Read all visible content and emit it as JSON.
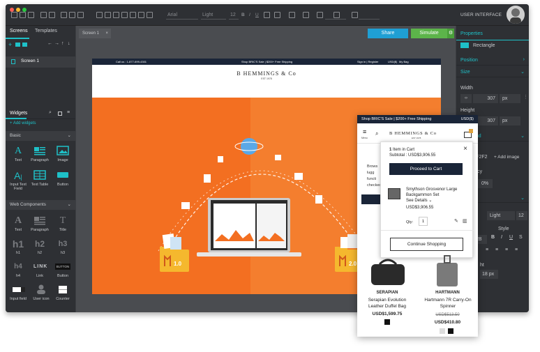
{
  "toolbar": {
    "font_name": "Arial",
    "font_weight": "Light",
    "font_size": "12",
    "view_label": "USER INTERFACE"
  },
  "left_panel": {
    "tabs": [
      "Screens",
      "Templates"
    ],
    "screens": [
      "Screen 1"
    ],
    "widgets_tab": "Widgets",
    "add_widgets": "+ Add widgets",
    "basic_label": "Basic",
    "basic_items": [
      "Text",
      "Paragraph",
      "Image",
      "Input Text Field",
      "Text Table",
      "Button"
    ],
    "web_components_label": "Web Components",
    "web_items": [
      "Text",
      "Paragraph",
      "Title",
      "h1",
      "h2",
      "h3",
      "h4",
      "Link",
      "Button",
      "Input field",
      "User icon",
      "Counter"
    ],
    "glyphs": {
      "h1": "h1",
      "h2": "h2",
      "h3": "h3",
      "h4": "h4",
      "link": "LINK",
      "button": "BUTTON"
    }
  },
  "center": {
    "tab_label": "Screen 1",
    "share_label": "Share",
    "simulate_label": "Simulate"
  },
  "site": {
    "top_left": "Call us : 1-877-699-4301",
    "top_center": "Shop BRIC'S Sale | $200+ Free Shipping",
    "top_right": "Sign in | Register",
    "top_currency": "USD($)",
    "top_bag": "My Bag",
    "logo": "B HEMMINGS & Co",
    "est": "EST 1978",
    "version_old": "1.0",
    "version_new": "2.0"
  },
  "right_panel": {
    "properties": "Properties",
    "shape": "Rectangle",
    "position": "Position",
    "size": "Size",
    "width_label": "Width",
    "width_value": "307",
    "width_unit": "px",
    "height_label": "Height",
    "height_value": "307",
    "height_unit": "px",
    "fill_fragment": "und",
    "hex_fragment": "F2F2F2",
    "add_image": "+ Add image",
    "opacity_fragment": "rency",
    "opacity_value": "0%",
    "font_weight": "Light",
    "font_size": "12",
    "style_label": "Style",
    "color_fragment": "2B",
    "line_fragment": "ht",
    "line_value": "18 px"
  },
  "mobile": {
    "top_banner": "Shop BRIC'S Sale | $200+ Free Shipping",
    "currency": "USD($)",
    "menu_label": "Menu",
    "logo": "B HEMMINGS & Co",
    "est": "EST 1978",
    "bg_text": [
      "Brows",
      "lugg",
      "functi",
      "checked"
    ],
    "cart": {
      "items_count": "1",
      "items_label": "Item in Cart",
      "subtotal": "Subtotal : USD$3,906.55",
      "proceed": "Proceed to Cart",
      "product_name": "Smythson Grosvenor Large Backgammon Set",
      "see_details": "See Details",
      "price": "USD$3,906.55",
      "qty_label": "Qty:",
      "qty_value": "1",
      "continue": "Continue Shopping"
    },
    "products": [
      {
        "brand": "SERAPIAN",
        "name": "Serapian Evolution Leather Duffel Bag",
        "price": "USD$1,599.75",
        "old_price": ""
      },
      {
        "brand": "HARTMANN",
        "name": "Hartmann 7R Carry-On Spinner",
        "price": "USD$410.80",
        "old_price": "USD$513.50"
      }
    ]
  },
  "colors": {
    "accent": "#1ec1c8",
    "orange": "#f36f21",
    "navy": "#1a2538",
    "share": "#1f9fd4",
    "simulate": "#5cb44a",
    "magento_folder": "#f5b82e"
  }
}
